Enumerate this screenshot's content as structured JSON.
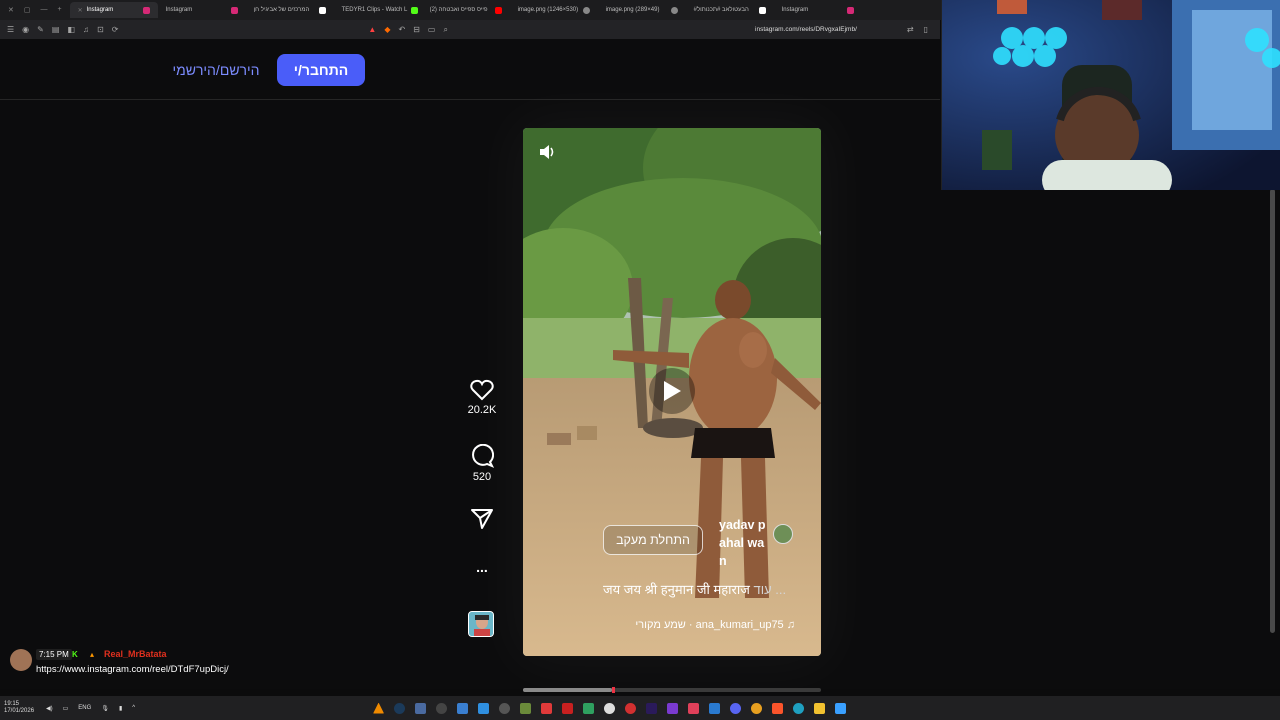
{
  "browser": {
    "tabs": [
      {
        "title": "Instagram",
        "color": "#d62976",
        "active": true
      },
      {
        "title": "Instagram",
        "color": "#d62976",
        "active": false
      },
      {
        "title": "המרכזים של אביגיל חן",
        "color": "#ffffff",
        "active": false
      },
      {
        "title": "TEDYR1 Clips - Watch L",
        "color": "#53fc18",
        "active": false
      },
      {
        "title": "(2) פייס ספייס ואבטחה",
        "color": "#ff0000",
        "active": false
      },
      {
        "title": "image.png (1246×530)",
        "color": "#888888",
        "active": false
      },
      {
        "title": "image.png (289×49)",
        "color": "#888888",
        "active": false
      },
      {
        "title": "#הבעטולאב #תכנותול",
        "color": "#ffffff",
        "active": false
      },
      {
        "title": "Instagram",
        "color": "#d62976",
        "active": false
      }
    ],
    "url": "instagram.com/reels/DRvgxaIEjmb/"
  },
  "header": {
    "login_label": "התחבר/י",
    "signup_label": "הירשם/הירשמי"
  },
  "reel": {
    "author": "yadav pahal wan",
    "follow_label": "התחלת מעקב",
    "caption": "जय जय श्री हनुमान जी महाराज",
    "caption_more": "... עוד",
    "audio": "ana_kumari_up75 · שמע מקורי",
    "progress": 0.3
  },
  "actions": {
    "likes": "20.2K",
    "comments": "520",
    "more": "..."
  },
  "chat": {
    "time": "7:15 PM",
    "username": "Real_MrBatata",
    "message": "https://www.instagram.com/reel/DTdF7upDicj/"
  },
  "taskbar": {
    "time": "19:15",
    "date": "17/01/2026",
    "lang": "ENG"
  }
}
